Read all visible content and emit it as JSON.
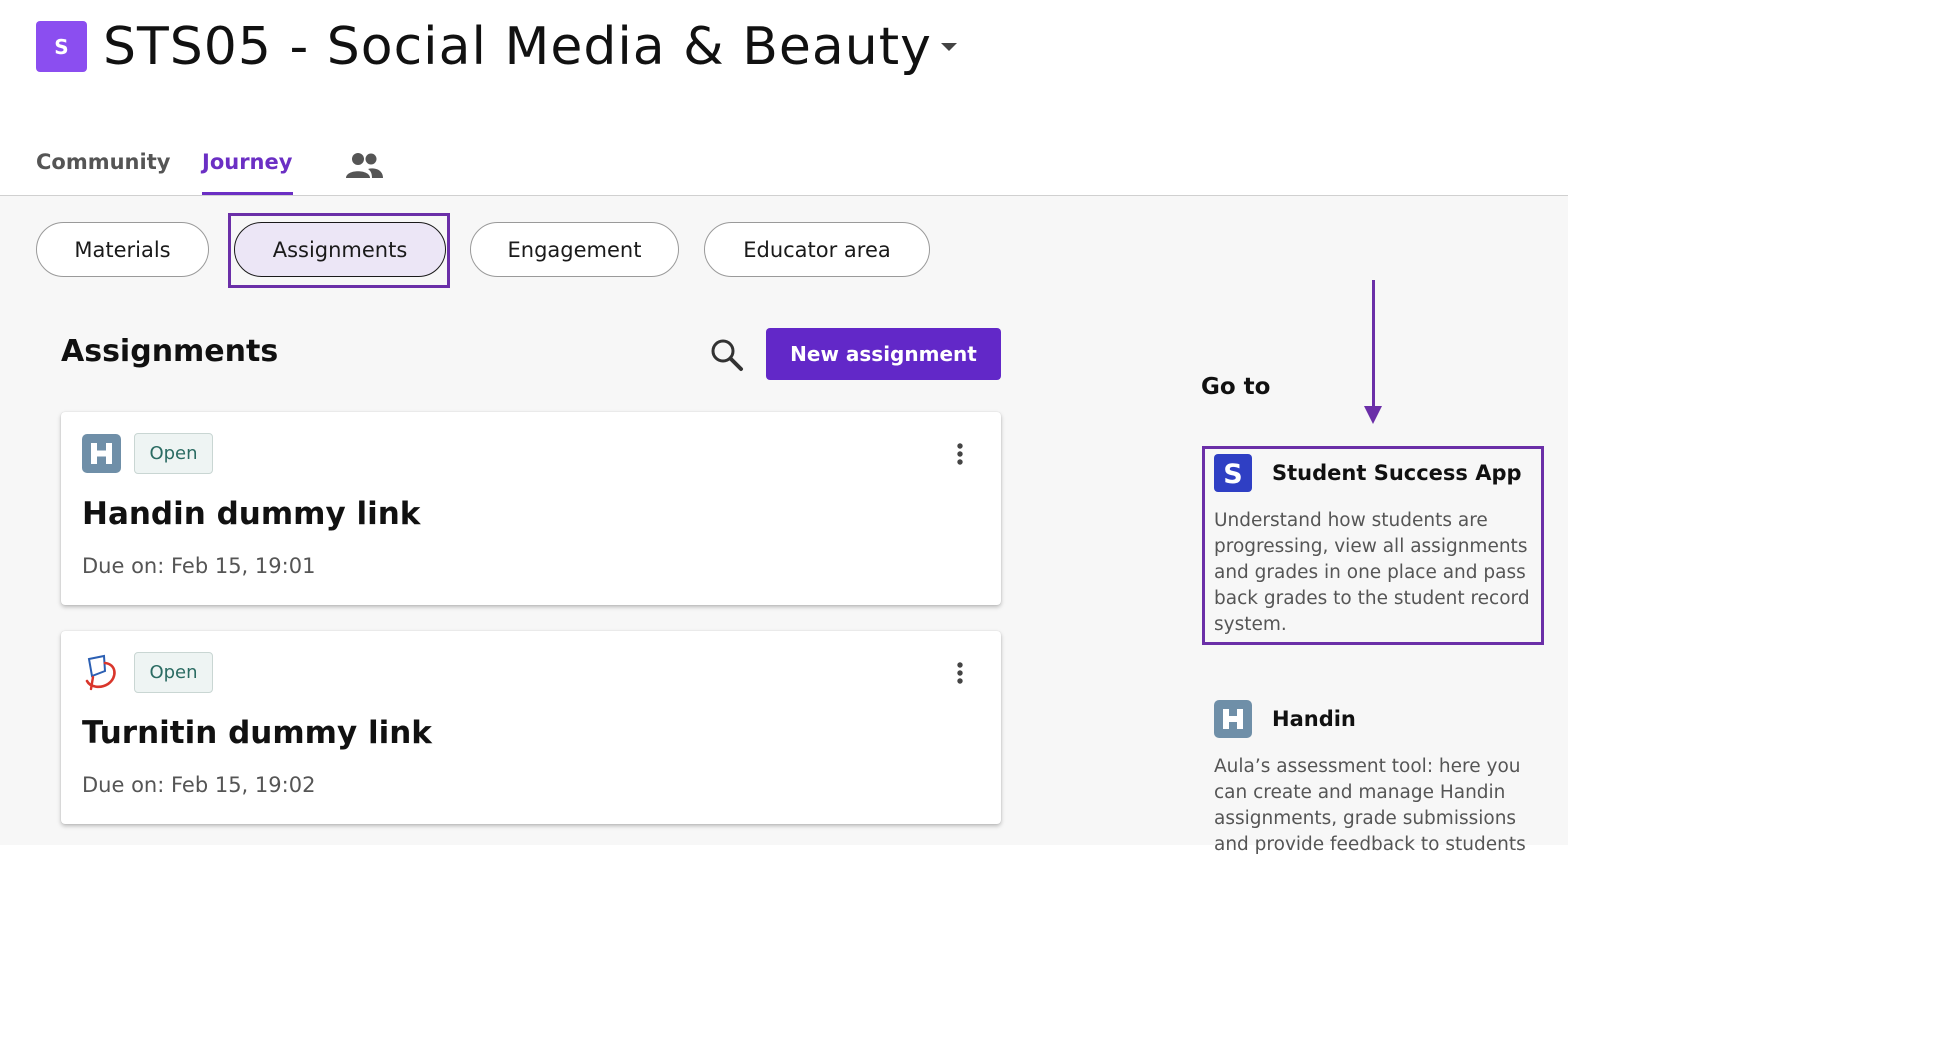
{
  "course": {
    "badge_letter": "S",
    "title": "STS05 - Social Media & Beauty"
  },
  "tabs": {
    "community": "Community",
    "journey": "Journey",
    "active": "journey",
    "people_icon": "people-icon"
  },
  "pills": {
    "materials": "Materials",
    "assignments": "Assignments",
    "engagement": "Engagement",
    "educator_area": "Educator area",
    "selected": "assignments"
  },
  "assignments": {
    "title": "Assignments",
    "search_icon": "search-icon",
    "new_button": "New assignment",
    "items": [
      {
        "tool_icon": "handin-icon",
        "status": "Open",
        "title": "Handin dummy link",
        "due": "Due on: Feb 15, 19:01"
      },
      {
        "tool_icon": "turnitin-icon",
        "status": "Open",
        "title": "Turnitin dummy link",
        "due": "Due on: Feb 15, 19:02"
      }
    ]
  },
  "goto": {
    "title": "Go to",
    "apps": [
      {
        "icon": "student-success-app-icon",
        "name": "Student Success App",
        "description": "Understand how students are progressing, view all assignments and grades in one place and pass back grades to the student record system."
      },
      {
        "icon": "handin-icon",
        "name": "Handin",
        "description": "Aula’s assessment tool: here you can create and manage Handin assignments, grade submissions and provide feedback to students"
      }
    ]
  },
  "colors": {
    "brand_purple": "#6228c8",
    "tab_active": "#6b2fc4",
    "course_badge": "#8b4ef0",
    "annotation": "#6b2fa8",
    "status_open_text": "#2a6b62",
    "handin_icon": "#6f8fa8",
    "ssa_icon": "#2f3fc4"
  }
}
